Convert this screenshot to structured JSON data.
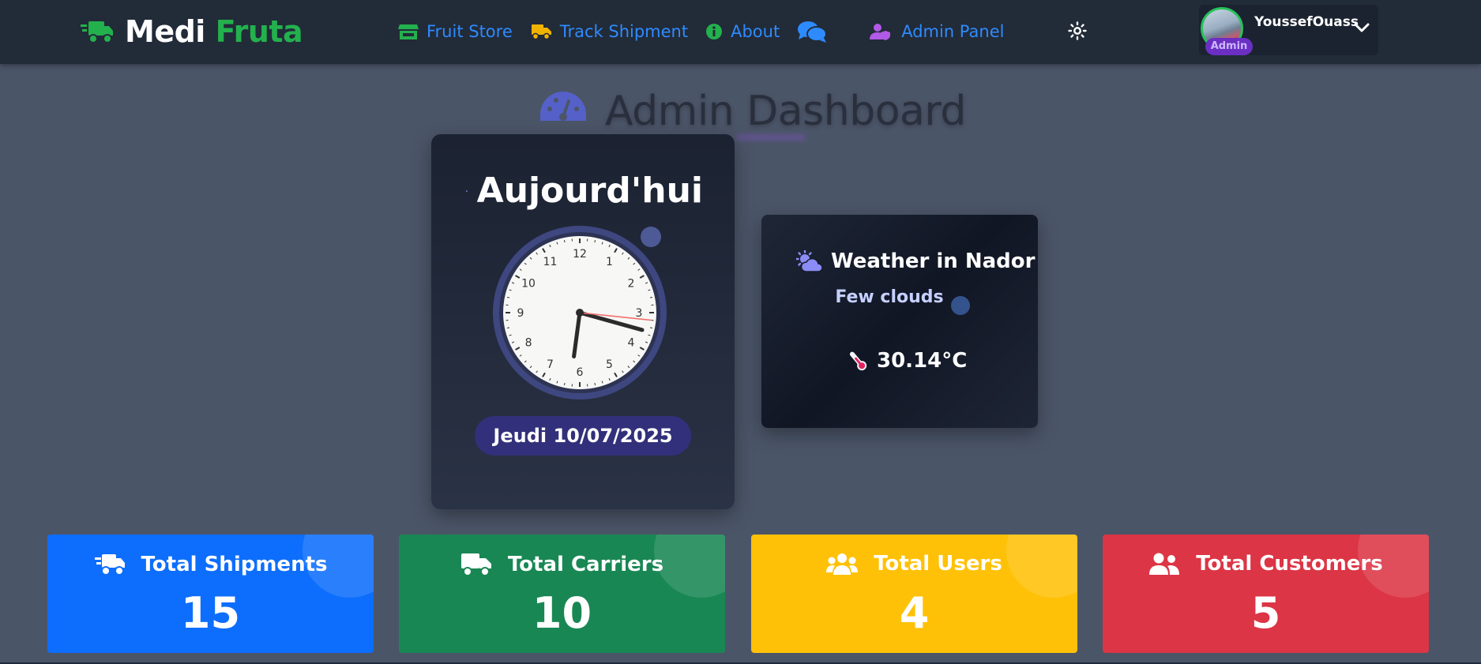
{
  "brand": {
    "part1": "Medi",
    "part2": "Fruta",
    "icon": "truck-fast-icon"
  },
  "nav": [
    {
      "label": "Fruit Store",
      "icon": "store-icon",
      "color": "#23b14d"
    },
    {
      "label": "Track Shipment",
      "icon": "truck-icon",
      "color": "#f0b400"
    },
    {
      "label": "About",
      "icon": "info-icon",
      "color": "#23b14d"
    },
    {
      "label": "",
      "icon": "chat-icon",
      "color": "#2e8bff"
    },
    {
      "label": "Admin Panel",
      "icon": "user-shield-icon",
      "color": "#b05ae6"
    }
  ],
  "theme_toggle": {
    "icon": "sun-icon"
  },
  "user": {
    "name": "YoussefOuass",
    "role": "Admin"
  },
  "page": {
    "title": "Admin Dashboard",
    "icon": "gauge-icon"
  },
  "clock_card": {
    "heading": "Aujourd'hui",
    "icon": "calendar-icon",
    "time": {
      "hour": 3,
      "minute": 31,
      "second": 16
    },
    "numbers": [
      "12",
      "1",
      "2",
      "3",
      "4",
      "5",
      "6",
      "7",
      "8",
      "9",
      "10",
      "11"
    ],
    "date": "Jeudi 10/07/2025"
  },
  "weather": {
    "heading": "Weather in Nador",
    "icon": "cloud-sun-icon",
    "description": "Few clouds",
    "temperature": "30.14°C",
    "temp_icon": "thermometer-icon"
  },
  "stats": [
    {
      "label": "Total Shipments",
      "value": "15",
      "color": "#0d6efd",
      "icon": "truck-fast-icon"
    },
    {
      "label": "Total Carriers",
      "value": "10",
      "color": "#198754",
      "icon": "truck-icon"
    },
    {
      "label": "Total Users",
      "value": "4",
      "color": "#ffc107",
      "icon": "users-icon"
    },
    {
      "label": "Total Customers",
      "value": "5",
      "color": "#dc3545",
      "icon": "user-group-icon"
    }
  ]
}
